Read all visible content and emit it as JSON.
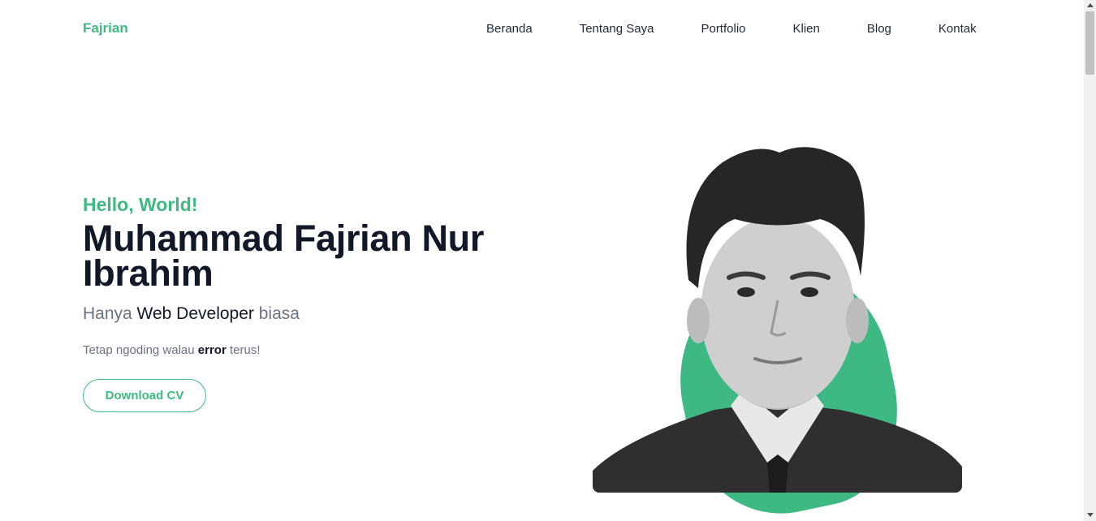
{
  "nav": {
    "brand": "Fajrian",
    "links": [
      "Beranda",
      "Tentang Saya",
      "Portfolio",
      "Klien",
      "Blog",
      "Kontak"
    ]
  },
  "hero": {
    "greeting": "Hello, World!",
    "name": "Muhammad Fajrian Nur Ibrahim",
    "tagline_prefix": "Hanya",
    "tagline_strong": "Web Developer",
    "tagline_suffix": "biasa",
    "motto_prefix": "Tetap ngoding walau",
    "motto_bold": "error",
    "motto_suffix": "terus!",
    "cv_button": "Download CV"
  },
  "colors": {
    "accent": "#3fb984",
    "heading": "#111827",
    "muted": "#6b7280"
  }
}
